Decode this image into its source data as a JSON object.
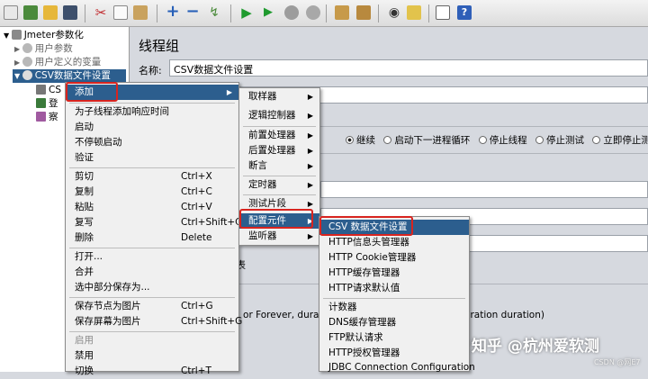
{
  "tree": {
    "root": "Jmeter参数化",
    "items": [
      "用户参数",
      "用户定义的变量",
      "CSV数据文件设置",
      "CS",
      "登",
      "察"
    ]
  },
  "panel": {
    "title": "线程组",
    "name_label": "名称:",
    "name_value": "CSV数据文件设置",
    "radio_options": [
      "继续",
      "启动下一进程循环",
      "停止线程",
      "停止测试",
      "立即停止测试"
    ],
    "selected_radio": "继续",
    "partial_text_1": "表",
    "partial_text_2": "1 or Forever, duratio",
    "partial_text_3": "eration duration)"
  },
  "context_menu": {
    "items": [
      {
        "label": "添加",
        "shortcut": "",
        "has_submenu": true,
        "selected": true,
        "disabled": false
      },
      {
        "label": "为子线程添加响应时间",
        "shortcut": "",
        "disabled": false
      },
      {
        "label": "启动",
        "shortcut": "",
        "disabled": false
      },
      {
        "label": "不停顿启动",
        "shortcut": "",
        "disabled": false
      },
      {
        "label": "验证",
        "shortcut": "",
        "disabled": false
      },
      {
        "label": "剪切",
        "shortcut": "Ctrl+X",
        "disabled": false
      },
      {
        "label": "复制",
        "shortcut": "Ctrl+C",
        "disabled": false
      },
      {
        "label": "粘贴",
        "shortcut": "Ctrl+V",
        "disabled": false
      },
      {
        "label": "复写",
        "shortcut": "Ctrl+Shift+C",
        "disabled": false
      },
      {
        "label": "删除",
        "shortcut": "Delete",
        "disabled": false
      },
      {
        "label": "打开...",
        "shortcut": "",
        "disabled": false
      },
      {
        "label": "合并",
        "shortcut": "",
        "disabled": false
      },
      {
        "label": "选中部分保存为...",
        "shortcut": "",
        "disabled": false
      },
      {
        "label": "保存节点为图片",
        "shortcut": "Ctrl+G",
        "disabled": false
      },
      {
        "label": "保存屏幕为图片",
        "shortcut": "Ctrl+Shift+G",
        "disabled": false
      },
      {
        "label": "启用",
        "shortcut": "",
        "disabled": true
      },
      {
        "label": "禁用",
        "shortcut": "",
        "disabled": false
      },
      {
        "label": "切换",
        "shortcut": "Ctrl+T",
        "disabled": false
      }
    ]
  },
  "submenu": {
    "items": [
      {
        "label": "取样器",
        "selected": false
      },
      {
        "label": "逻辑控制器",
        "selected": false
      },
      {
        "label": "前置处理器",
        "selected": false
      },
      {
        "label": "后置处理器",
        "selected": false
      },
      {
        "label": "断言",
        "selected": false
      },
      {
        "label": "定时器",
        "selected": false
      },
      {
        "label": "测试片段",
        "selected": false
      },
      {
        "label": "配置元件",
        "selected": true
      },
      {
        "label": "监听器",
        "selected": false
      }
    ]
  },
  "config_submenu": {
    "items": [
      {
        "label": "CSV 数据文件设置",
        "selected": true
      },
      {
        "label": "HTTP信息头管理器",
        "selected": false
      },
      {
        "label": "HTTP Cookie管理器",
        "selected": false
      },
      {
        "label": "HTTP缓存管理器",
        "selected": false
      },
      {
        "label": "HTTP请求默认值",
        "selected": false
      },
      {
        "label": "计数器",
        "selected": false
      },
      {
        "label": "DNS缓存管理器",
        "selected": false
      },
      {
        "label": "FTP默认请求",
        "selected": false
      },
      {
        "label": "HTTP授权管理器",
        "selected": false
      },
      {
        "label": "JDBC Connection Configuration",
        "selected": false
      }
    ]
  },
  "watermark": {
    "main": "知乎 @杭州爱软测",
    "small": "CSDN @网E7"
  },
  "colors": {
    "selection": "#2c5e8e",
    "highlight_box": "#d8241f",
    "panel_bg": "#d6d9df"
  }
}
